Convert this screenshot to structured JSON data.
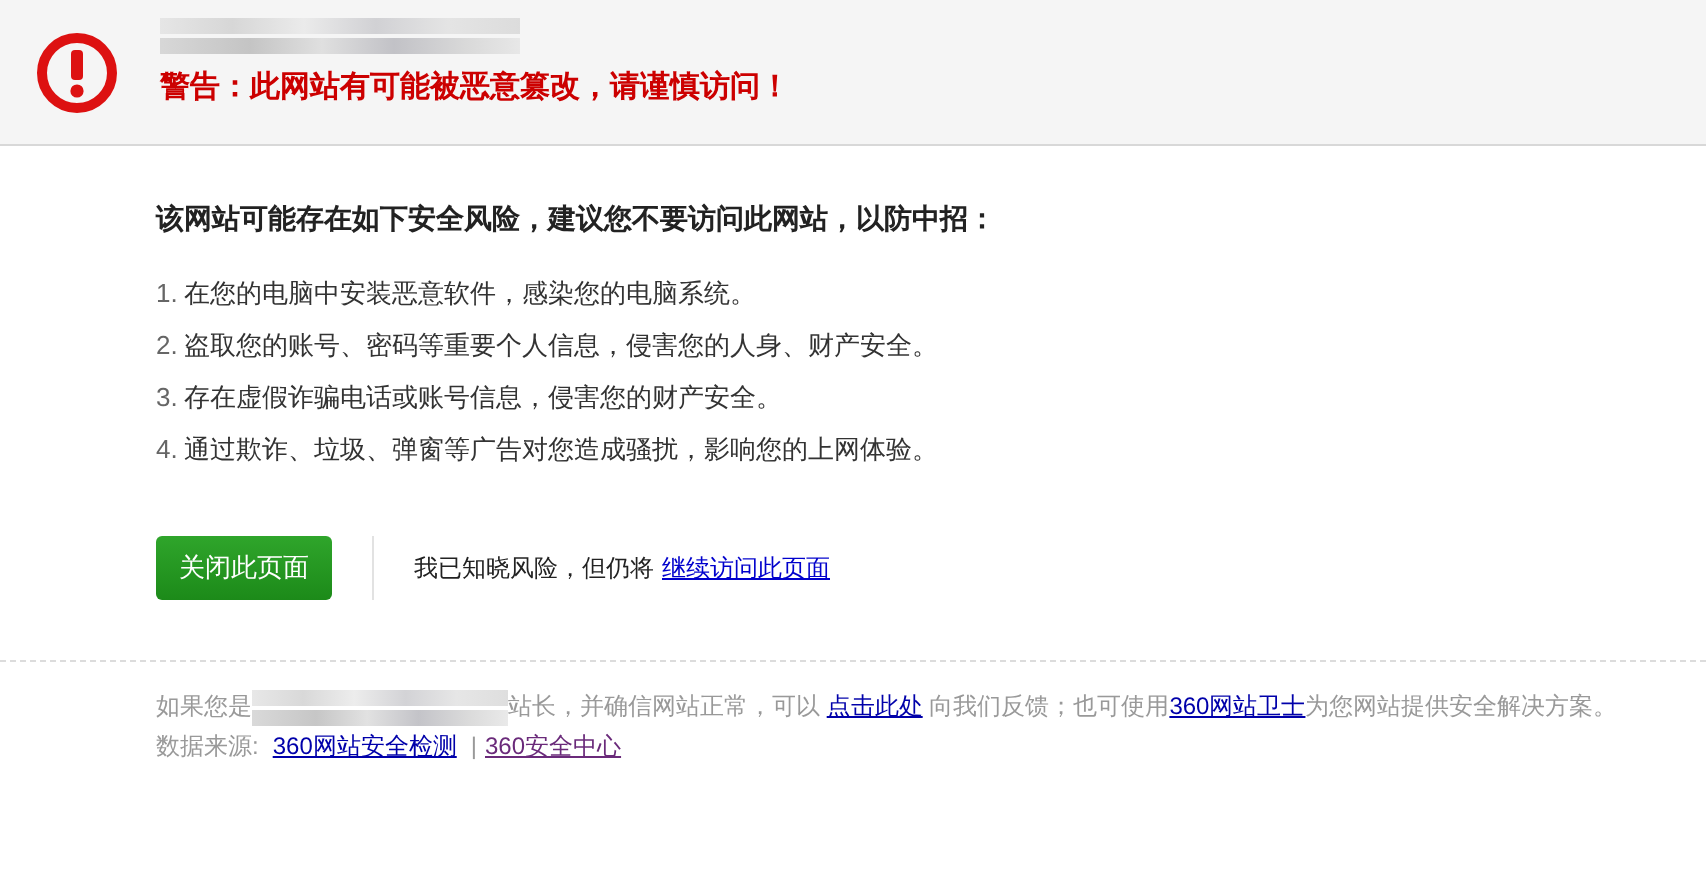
{
  "header": {
    "warning": "警告：此网站有可能被恶意篡改，请谨慎访问！"
  },
  "risks": {
    "heading": "该网站可能存在如下安全风险，建议您不要访问此网站，以防中招：",
    "items": [
      {
        "number": "1.",
        "text": "在您的电脑中安装恶意软件，感染您的电脑系统。"
      },
      {
        "number": "2.",
        "text": "盗取您的账号、密码等重要个人信息，侵害您的人身、财产安全。"
      },
      {
        "number": "3.",
        "text": "存在虚假诈骗电话或账号信息，侵害您的财产安全。"
      },
      {
        "number": "4.",
        "text": "通过欺诈、垃圾、弹窗等广告对您造成骚扰，影响您的上网体验。"
      }
    ]
  },
  "actions": {
    "close_button": "关闭此页面",
    "notice": "我已知晓风险，但仍将",
    "continue_link": "继续访问此页面"
  },
  "footer": {
    "parts": [
      {
        "kind": "text",
        "text": "如果您是"
      },
      {
        "kind": "blur"
      },
      {
        "kind": "text",
        "text": "站长，并确信网站正常，可以 "
      },
      {
        "kind": "link",
        "text": "点击此处"
      },
      {
        "kind": "text",
        "text": " 向我们反馈；也可使用"
      },
      {
        "kind": "link",
        "text": "360网站卫士"
      },
      {
        "kind": "text",
        "text": "为您网站提供安全解决方案。"
      }
    ],
    "source_label": "数据来源:",
    "sources": [
      {
        "text": "360网站安全检测",
        "visited": false
      },
      {
        "text": "360安全中心",
        "visited": true
      }
    ],
    "separator": "|"
  }
}
